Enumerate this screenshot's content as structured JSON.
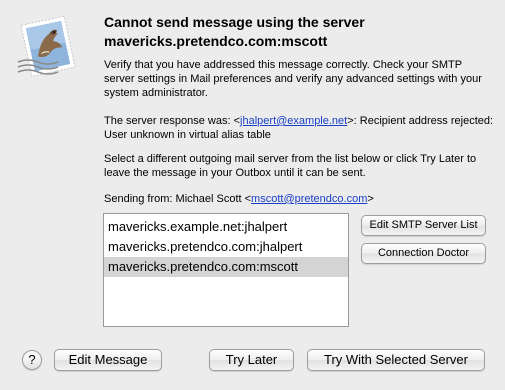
{
  "dialog": {
    "title_line1": "Cannot send message using the server",
    "title_line2": "mavericks.pretendco.com:mscott",
    "para1": "Verify that you have addressed this message correctly. Check your SMTP server settings in Mail preferences and verify any advanced settings with your system administrator.",
    "response_prefix": "The server response was: <",
    "response_email": "jhalpert@example.net",
    "response_suffix": ">: Recipient address rejected: User unknown in virtual alias table",
    "para3": "Select a different outgoing mail server from the list below or click Try Later to leave the message in your Outbox until it can be sent.",
    "sending_prefix": "Sending from: Michael Scott <",
    "sending_email": "mscott@pretendco.com",
    "sending_suffix": ">"
  },
  "servers": [
    {
      "label": "mavericks.example.net:jhalpert",
      "selected": false
    },
    {
      "label": "mavericks.pretendco.com:jhalpert",
      "selected": false
    },
    {
      "label": "mavericks.pretendco.com:mscott",
      "selected": true
    }
  ],
  "buttons": {
    "edit_smtp": "Edit SMTP Server List",
    "connection_doctor": "Connection Doctor",
    "help": "?",
    "edit_message": "Edit Message",
    "try_later": "Try Later",
    "try_selected": "Try With Selected Server"
  },
  "icon": {
    "name": "mail-stamp-icon"
  }
}
